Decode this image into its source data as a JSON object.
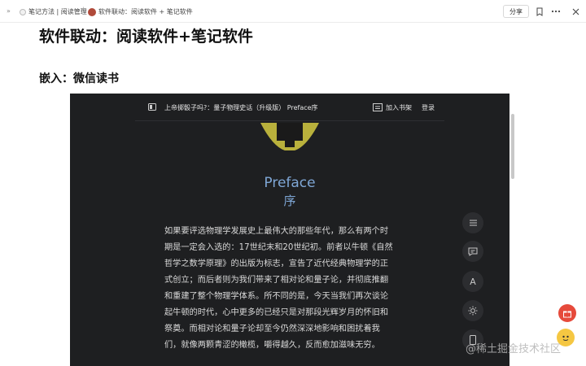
{
  "topbar": {
    "breadcrumb_root": "笔记方法 | 阅读管理",
    "breadcrumb_sep": "/",
    "breadcrumb_current": "软件联动：阅读软件 + 笔记软件",
    "share_label": "分享"
  },
  "doc": {
    "title": "软件联动：阅读软件+笔记软件",
    "section_heading": "嵌入：微信读书"
  },
  "reader": {
    "book_title": "上帝掷骰子吗?：量子物理史话（升级版） Preface序",
    "add_shelf_label": "加入书架",
    "login_label": "登录",
    "chapter_title_en": "Preface",
    "chapter_title_zh": "序",
    "paragraph_lines": [
      "如果要评选物理学发展史上最伟大的那些年代，那么有两个时",
      "期是一定会入选的：17世纪末和20世纪初。前者以牛顿《自然",
      "哲学之数学原理》的出版为标志，宣告了近代经典物理学的正",
      "式创立；而后者则为我们带来了相对论和量子论，并彻底推翻",
      "和重建了整个物理学体系。所不同的是，今天当我们再次谈论",
      "起牛顿的时代，心中更多的已经只是对那段光辉岁月的怀旧和",
      "祭奠。而相对论和量子论却至今仍然深深地影响和困扰着我",
      "们，就像两颗青涩的橄榄，嚼得越久，反而愈加滋味无穷。"
    ],
    "fab_font_label": "A"
  },
  "watermark": "@稀土掘金技术社区",
  "colors": {
    "reader_bg": "#1e1f21",
    "reader_accent": "#7fa7d6",
    "gift_button": "#e64a3b",
    "robot_button": "#f5c742"
  }
}
